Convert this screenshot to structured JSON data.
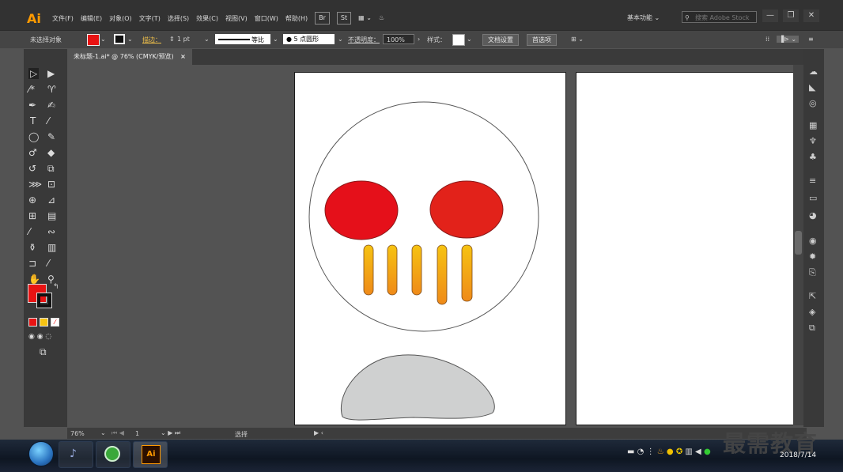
{
  "app": {
    "logo": "Ai"
  },
  "menubar": {
    "items": [
      "文件(F)",
      "编辑(E)",
      "对象(O)",
      "文字(T)",
      "选择(S)",
      "效果(C)",
      "视图(V)",
      "窗口(W)",
      "帮助(H)"
    ],
    "bridge_label": "Br",
    "stock_label": "St",
    "workspace_label": "基本功能 ⌄",
    "search_placeholder": "搜索 Adobe Stock"
  },
  "control_bar": {
    "selection_label": "未选择对象",
    "stroke_label": "描边：",
    "stroke_value": "1 pt",
    "profile_label": "等比",
    "brush_label": "5 点圆形",
    "opacity_label": "不透明度：",
    "opacity_value": "100%",
    "style_label": "样式：",
    "doc_setup_button": "文档设置",
    "preferences_button": "首选项"
  },
  "document": {
    "tab_title": "未标题-1.ai* @ 76% (CMYK/预览)",
    "close_glyph": "×"
  },
  "status": {
    "zoom": "76%",
    "artboard": "1",
    "tool_hint": "选择"
  },
  "taskbar": {
    "app_label": "Ai",
    "date": "2018/7/14"
  },
  "watermark": "最需教育",
  "colors": {
    "fill": "#e81313",
    "eye_left": "#e5101a",
    "eye_right": "#e2221a",
    "bar_top": "#f6c312",
    "bar_bottom": "#ef8a19",
    "blob": "#cfd0d0",
    "accent_ai": "#ff9a00"
  },
  "icons": [
    "selection-tool-icon",
    "direct-selection-tool-icon",
    "magic-wand-icon",
    "lasso-icon",
    "pen-tool-icon",
    "curvature-tool-icon",
    "type-tool-icon",
    "line-tool-icon",
    "ellipse-tool-icon",
    "paintbrush-icon",
    "shaper-tool-icon",
    "eraser-icon",
    "rotate-tool-icon",
    "scale-tool-icon",
    "width-tool-icon",
    "free-transform-icon",
    "shape-builder-icon",
    "perspective-grid-icon",
    "mesh-tool-icon",
    "gradient-tool-icon",
    "eyedropper-icon",
    "blend-tool-icon",
    "symbol-sprayer-icon",
    "graph-tool-icon",
    "artboard-tool-icon",
    "slice-tool-icon",
    "hand-tool-icon",
    "zoom-tool-icon"
  ]
}
